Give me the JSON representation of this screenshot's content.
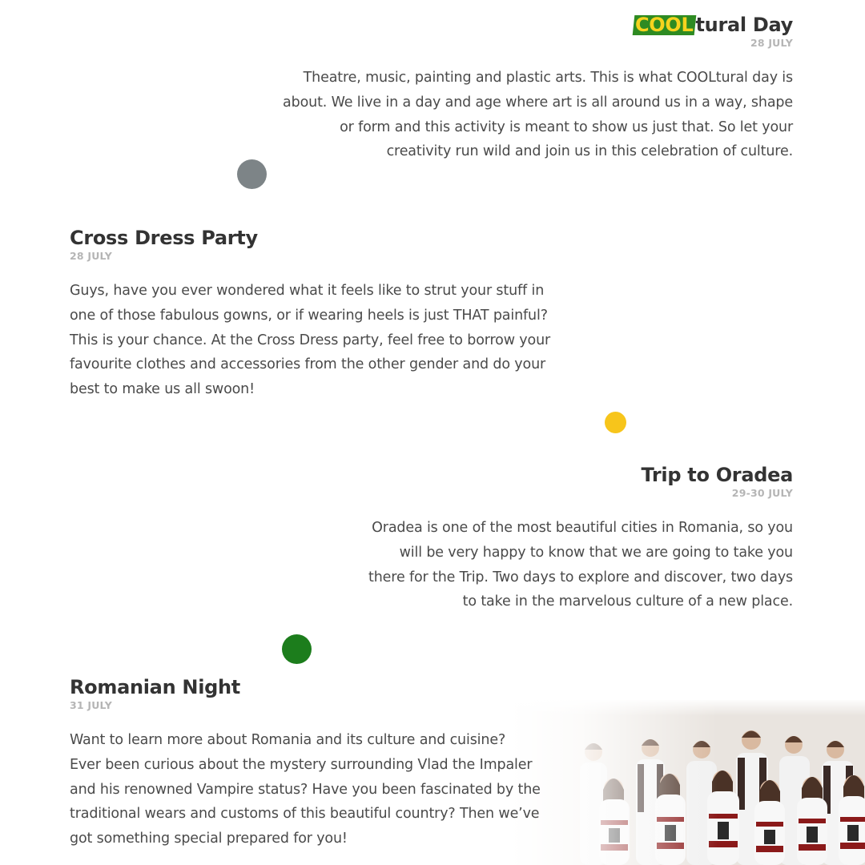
{
  "events": [
    {
      "title_highlight": "COOL",
      "title_rest": "tural Day",
      "date": "28 JULY",
      "description": "Theatre, music, painting and plastic arts. This is what COOLtural day is\nabout. We live in a day and age where art is all around us in a way, shape\nor form and this activity is meant to show us just that. So let your\ncreativity run wild and join us in this celebration of culture."
    },
    {
      "title": "Cross Dress Party",
      "date": "28 JULY",
      "description": "Guys, have you ever wondered what it feels like to strut your stuff in\none of those fabulous gowns, or if wearing heels is just THAT painful?\nThis is your chance.  At the Cross Dress party, feel free to borrow your\nfavourite clothes and accessories from the other gender and do your\nbest to make us all swoon!"
    },
    {
      "title": "Trip to Oradea",
      "date": "29-30 JULY",
      "description": "Oradea is one of the most beautiful cities in Romania, so you\nwill be very happy to know that we are going to take you\nthere for the Trip. Two days to explore and discover, two days\nto take in the marvelous culture of a new place."
    },
    {
      "title": "Romanian Night",
      "date": "31 JULY",
      "description": "Want to learn more about Romania and its culture and cuisine?\nEver been curious about the mystery surrounding Vlad the Impaler\nand his renowned Vampire status? Have you been fascinated by the\ntraditional wears and customs of this beautiful country? Then we’ve\ngot something special prepared for you!"
    }
  ],
  "colors": {
    "dot_gray": "#7d8487",
    "dot_yellow": "#f7c51b",
    "dot_green": "#1c7d1c",
    "highlight_bg": "#2e8b22",
    "highlight_text": "#f6d31e"
  },
  "photo": {
    "icon": "group-photo-icon"
  }
}
